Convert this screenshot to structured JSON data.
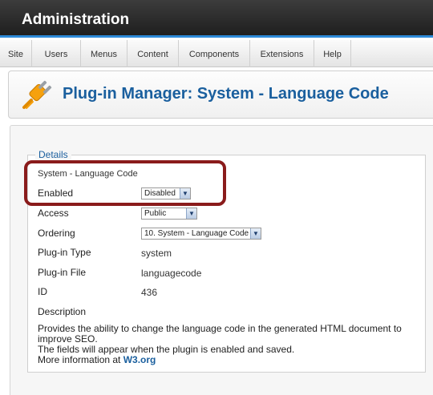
{
  "header": {
    "title": "Administration"
  },
  "menu": {
    "items": [
      {
        "label": "Site"
      },
      {
        "label": "Users"
      },
      {
        "label": "Menus"
      },
      {
        "label": "Content"
      },
      {
        "label": "Components"
      },
      {
        "label": "Extensions"
      },
      {
        "label": "Help"
      }
    ]
  },
  "toolbar": {
    "title": "Plug-in Manager: System - Language Code",
    "icon": "plugin-icon"
  },
  "details": {
    "legend": "Details",
    "plugin_name": "System - Language Code",
    "enabled_label": "Enabled",
    "enabled_value": "Disabled",
    "access_label": "Access",
    "access_value": "Public",
    "ordering_label": "Ordering",
    "ordering_value": "10. System - Language Code",
    "type_label": "Plug-in Type",
    "type_value": "system",
    "file_label": "Plug-in File",
    "file_value": "languagecode",
    "id_label": "ID",
    "id_value": "436",
    "description_label": "Description",
    "description_line1": "Provides the ability to change the language code in the generated HTML document to improve SEO.",
    "description_line2": "The fields will appear when the plugin is enabled and saved.",
    "description_line3_prefix": "More information at ",
    "description_link": "W3.org"
  },
  "colors": {
    "title_blue": "#1a5f9e",
    "highlight_red": "#8a1b1b",
    "header_dark": "#2a2a2a"
  }
}
